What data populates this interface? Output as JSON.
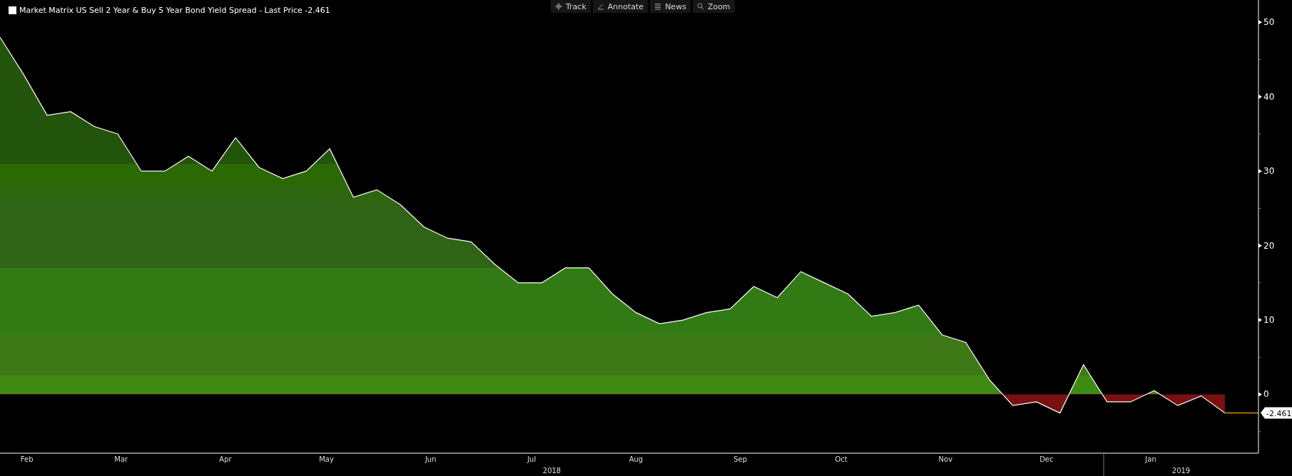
{
  "legend": {
    "title": "Market Matrix US Sell 2 Year & Buy 5 Year Bond Yield Spread - Last Price -2.461",
    "color": "#ffffff"
  },
  "toolbar": [
    {
      "label": "Track",
      "kind": "track"
    },
    {
      "label": "Annotate",
      "kind": "annotate"
    },
    {
      "label": "News",
      "kind": "news"
    },
    {
      "label": "Zoom",
      "kind": "zoom"
    }
  ],
  "chart": {
    "last_price_label": "-2.461",
    "years": [
      "2018",
      "2019"
    ],
    "chart_data": {
      "type": "area",
      "x": [
        "2018-02-07",
        "2018-02-14",
        "2018-02-21",
        "2018-02-28",
        "2018-03-07",
        "2018-03-14",
        "2018-03-21",
        "2018-03-28",
        "2018-04-04",
        "2018-04-11",
        "2018-04-18",
        "2018-04-25",
        "2018-05-02",
        "2018-05-09",
        "2018-05-16",
        "2018-05-23",
        "2018-05-30",
        "2018-06-06",
        "2018-06-13",
        "2018-06-20",
        "2018-06-27",
        "2018-07-04",
        "2018-07-11",
        "2018-07-18",
        "2018-07-25",
        "2018-08-01",
        "2018-08-08",
        "2018-08-15",
        "2018-08-22",
        "2018-08-29",
        "2018-09-05",
        "2018-09-12",
        "2018-09-19",
        "2018-09-26",
        "2018-10-03",
        "2018-10-10",
        "2018-10-17",
        "2018-10-24",
        "2018-10-31",
        "2018-11-07",
        "2018-11-14",
        "2018-11-21",
        "2018-11-28",
        "2018-12-05",
        "2018-12-12",
        "2018-12-19",
        "2018-12-26",
        "2019-01-02",
        "2019-01-09",
        "2019-01-16",
        "2019-01-23",
        "2019-01-30",
        "2019-02-06"
      ],
      "series": [
        {
          "color": "#ffffff",
          "values": [
            48,
            43,
            37.5,
            38,
            36,
            35,
            30,
            30,
            32,
            30,
            34.5,
            30.5,
            29,
            30,
            33,
            26.5,
            27.5,
            25.5,
            22.5,
            21,
            20.5,
            17.5,
            15,
            15,
            17,
            17,
            13.5,
            11,
            9.5,
            10,
            11,
            11.5,
            14.5,
            13,
            16.5,
            15,
            13.5,
            10.5,
            11,
            12,
            8,
            7,
            2,
            -1.5,
            -1,
            -2.5,
            4,
            -1,
            -1,
            0.5,
            -1.5,
            -0.2,
            -2.5
          ]
        }
      ],
      "xlim": [
        "2018-02-07",
        "2019-02-16"
      ],
      "ylim": [
        -7.9,
        53
      ],
      "yticks": [
        0,
        10,
        20,
        30,
        40,
        50
      ],
      "xticks": [
        {
          "value": "2018-02-15",
          "label": "Feb"
        },
        {
          "value": "2018-03-15",
          "label": "Mar"
        },
        {
          "value": "2018-04-15",
          "label": "Apr"
        },
        {
          "value": "2018-05-15",
          "label": "May"
        },
        {
          "value": "2018-06-15",
          "label": "Jun"
        },
        {
          "value": "2018-07-15",
          "label": "Jul"
        },
        {
          "value": "2018-08-15",
          "label": "Aug"
        },
        {
          "value": "2018-09-15",
          "label": "Sep"
        },
        {
          "value": "2018-10-15",
          "label": "Oct"
        },
        {
          "value": "2018-11-15",
          "label": "Nov"
        },
        {
          "value": "2018-12-15",
          "label": "Dec"
        },
        {
          "value": "2019-01-15",
          "label": "Jan"
        }
      ]
    }
  }
}
